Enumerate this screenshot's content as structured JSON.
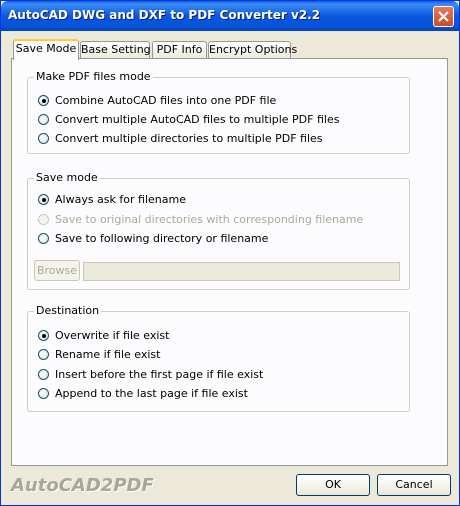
{
  "window": {
    "title": "AutoCAD DWG and DXF to PDF Converter v2.2"
  },
  "tabs": [
    {
      "label": "Save Mode",
      "active": true
    },
    {
      "label": "Base Setting",
      "active": false
    },
    {
      "label": "PDF Info",
      "active": false
    },
    {
      "label": "Encrypt Options",
      "active": false
    }
  ],
  "make_pdf_mode": {
    "legend": "Make PDF files mode",
    "options": [
      {
        "label": "Combine AutoCAD files into one PDF file",
        "checked": true
      },
      {
        "label": "Convert multiple AutoCAD files to multiple PDF files",
        "checked": false
      },
      {
        "label": "Convert multiple directories to multiple PDF files",
        "checked": false
      }
    ]
  },
  "save_mode": {
    "legend": "Save mode",
    "options": [
      {
        "label": "Always ask for filename",
        "checked": true,
        "disabled": false
      },
      {
        "label": "Save to original directories with corresponding filename",
        "checked": false,
        "disabled": true
      },
      {
        "label": "Save to following directory or filename",
        "checked": false,
        "disabled": false
      }
    ],
    "browse_label": "Browse",
    "path_value": ""
  },
  "destination": {
    "legend": "Destination",
    "options": [
      {
        "label": "Overwrite if file exist",
        "checked": true
      },
      {
        "label": "Rename if file exist",
        "checked": false
      },
      {
        "label": "Insert before the first page if file exist",
        "checked": false
      },
      {
        "label": "Append to the last page if file exist",
        "checked": false
      }
    ]
  },
  "footer": {
    "logo_text": "AutoCAD2PDF",
    "ok_label": "OK",
    "cancel_label": "Cancel"
  },
  "colors": {
    "titlebar": "#0553d9",
    "close_button": "#c94b29",
    "tab_highlight": "#ffc83c"
  }
}
